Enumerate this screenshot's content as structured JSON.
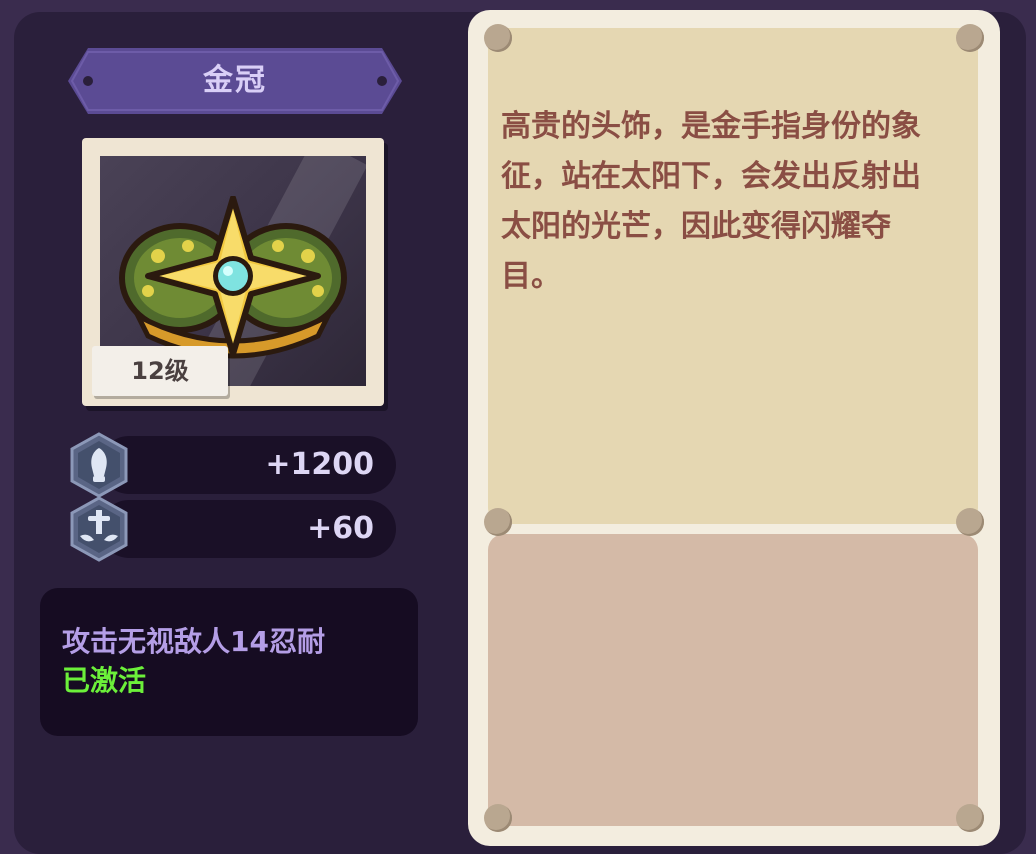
{
  "item": {
    "name": "金冠",
    "level": "12级",
    "icon": "golden-crown-icon"
  },
  "stats": [
    {
      "icon": "attack-icon",
      "value": "+1200"
    },
    {
      "icon": "sword-defense-icon",
      "value": "+60"
    }
  ],
  "effect": {
    "text": "攻击无视敌人14忍耐",
    "status": "已激活",
    "status_color": "#6cf03a"
  },
  "description": "高贵的头饰，是金手指身份的象征，站在太阳下，会发出反射出太阳的光芒，因此变得闪耀夺目。",
  "colors": {
    "panel": "#2a1f3b",
    "banner": "#5b4b94",
    "card": "#f3eddf",
    "desc_bg": "#e5d7b2",
    "desc_text": "#8a4e44"
  }
}
